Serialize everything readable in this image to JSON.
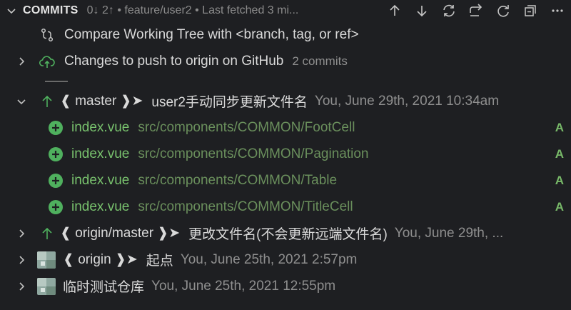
{
  "section": {
    "title": "COMMITS",
    "description": "0↓ 2↑ • feature/user2 • Last fetched 3 mi..."
  },
  "toolbar": [
    {
      "name": "push-icon"
    },
    {
      "name": "pull-icon"
    },
    {
      "name": "sync-icon"
    },
    {
      "name": "switch-branch-icon"
    },
    {
      "name": "refresh-icon"
    },
    {
      "name": "collapse-all-icon"
    },
    {
      "name": "more-actions-icon"
    }
  ],
  "compare": {
    "label": "Compare Working Tree with <branch, tag, or ref>"
  },
  "changes": {
    "label": "Changes to push to origin on GitHub",
    "count": "2 commits"
  },
  "commits": [
    {
      "branch": "❰ master ❱➤",
      "message": "user2手动同步更新文件名",
      "meta": "You, June 29th, 2021 10:34am",
      "files": [
        {
          "name": "index.vue",
          "path": "src/components/COMMON/FootCell",
          "status": "A"
        },
        {
          "name": "index.vue",
          "path": "src/components/COMMON/Pagination",
          "status": "A"
        },
        {
          "name": "index.vue",
          "path": "src/components/COMMON/Table",
          "status": "A"
        },
        {
          "name": "index.vue",
          "path": "src/components/COMMON/TitleCell",
          "status": "A"
        }
      ]
    },
    {
      "branch": "❰ origin/master ❱➤",
      "message": "更改文件名(不会更新远端文件名)",
      "meta": "You, June 29th, ..."
    },
    {
      "branch": "❰ origin ❱➤",
      "message": "起点",
      "meta": "You, June 25th, 2021 2:57pm"
    },
    {
      "branch": "",
      "message": "临时测试仓库",
      "meta": "You, June 25th, 2021 12:55pm"
    }
  ],
  "colors": {
    "accent_green": "#4fb05e",
    "background": "#1e1f22"
  }
}
